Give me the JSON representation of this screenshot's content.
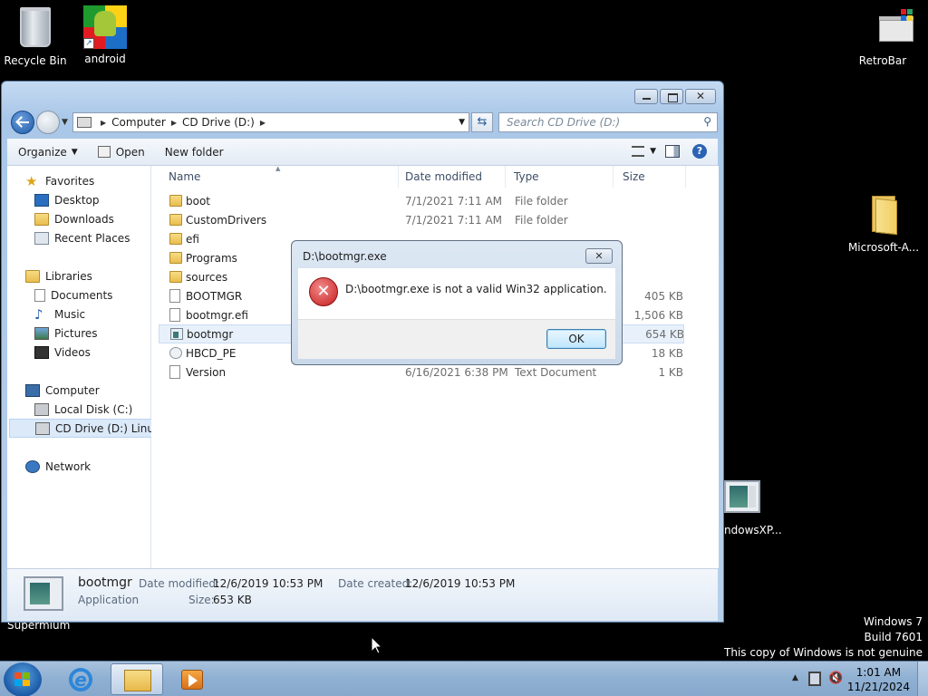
{
  "desktop": {
    "icons": {
      "recycle_bin": "Recycle Bin",
      "android": "android",
      "retrobar": "RetroBar",
      "microsoft": "Microsoft-A...",
      "windowsxp": "ndowsXP..."
    },
    "supermium": "Supermium",
    "watermark": {
      "line1": "Windows 7",
      "line2": "Build 7601",
      "line3": "This copy of Windows is not genuine"
    }
  },
  "explorer": {
    "address": {
      "crumbs": [
        "Computer",
        "CD Drive (D:)"
      ]
    },
    "search_placeholder": "Search CD Drive (D:)",
    "toolbar": {
      "organize": "Organize",
      "open": "Open",
      "new_folder": "New folder"
    },
    "nav": {
      "favorites": "Favorites",
      "desktop": "Desktop",
      "downloads": "Downloads",
      "recent_places": "Recent Places",
      "libraries": "Libraries",
      "documents": "Documents",
      "music": "Music",
      "pictures": "Pictures",
      "videos": "Videos",
      "computer": "Computer",
      "local_disk": "Local Disk (C:)",
      "cd_drive": "CD Drive (D:) Linux M",
      "network": "Network"
    },
    "columns": {
      "name": "Name",
      "date": "Date modified",
      "type": "Type",
      "size": "Size"
    },
    "files": [
      {
        "name": "boot",
        "date": "7/1/2021 7:11 AM",
        "type": "File folder",
        "size": ""
      },
      {
        "name": "CustomDrivers",
        "date": "7/1/2021 7:11 AM",
        "type": "File folder",
        "size": ""
      },
      {
        "name": "efi",
        "date": "",
        "type": "",
        "size": ""
      },
      {
        "name": "Programs",
        "date": "",
        "type": "",
        "size": ""
      },
      {
        "name": "sources",
        "date": "",
        "type": "",
        "size": ""
      },
      {
        "name": "BOOTMGR",
        "date": "",
        "type": "",
        "size": "405 KB"
      },
      {
        "name": "bootmgr.efi",
        "date": "",
        "type": "",
        "size": "1,506 KB"
      },
      {
        "name": "bootmgr",
        "date": "",
        "type": "",
        "size": "654 KB"
      },
      {
        "name": "HBCD_PE",
        "date": "",
        "type": "",
        "size": "18 KB"
      },
      {
        "name": "Version",
        "date": "6/16/2021 6:38 PM",
        "type": "Text Document",
        "size": "1 KB"
      }
    ],
    "details": {
      "name": "bootmgr",
      "kind": "Application",
      "modified_label": "Date modified:",
      "modified": "12/6/2019 10:53 PM",
      "created_label": "Date created:",
      "created": "12/6/2019 10:53 PM",
      "size_label": "Size:",
      "size": "653 KB"
    }
  },
  "dialog": {
    "title": "D:\\bootmgr.exe",
    "message": "D:\\bootmgr.exe is not a valid Win32 application.",
    "ok": "OK"
  },
  "taskbar": {
    "time": "1:01 AM",
    "date": "11/21/2024"
  }
}
